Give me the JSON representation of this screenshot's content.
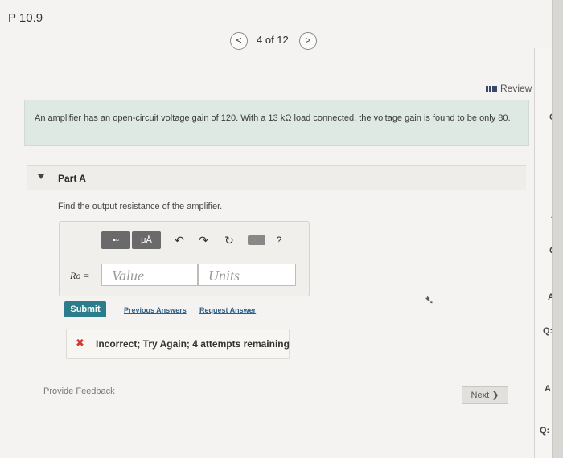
{
  "problem": {
    "title": "P 10.9"
  },
  "pager": {
    "prev_icon": "<",
    "count_text": "4 of 12",
    "next_icon": ">"
  },
  "review": {
    "label": "Review"
  },
  "problem_statement": {
    "text": "An amplifier has an open-circuit voltage gain of 120. With a 13  kΩ load connected, the voltage gain is found to be only 80."
  },
  "part": {
    "label": "Part A",
    "question": "Find the output resistance of the amplifier."
  },
  "toolbar": {
    "templates_icon": "▪▫",
    "greek_label": "μÅ",
    "undo_icon": "↶",
    "redo_icon": "↷",
    "reset_icon": "↻",
    "help_label": "?"
  },
  "answer": {
    "variable_label": "Ro =",
    "value_placeholder": "Value",
    "units_placeholder": "Units"
  },
  "actions": {
    "submit_label": "Submit",
    "previous_answers_label": "Previous Answers",
    "request_answer_label": "Request Answer"
  },
  "feedback": {
    "message": "Incorrect; Try Again; 4 attempts remaining"
  },
  "footer": {
    "provide_feedback_label": "Provide Feedback",
    "next_label": "Next ❯"
  },
  "colors": {
    "accent": "#2c7d8b",
    "error": "#d13b34",
    "problem_bg": "#dfe9e4"
  }
}
